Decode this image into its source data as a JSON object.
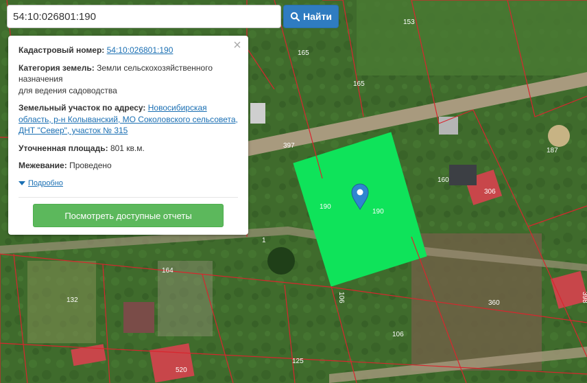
{
  "search": {
    "value": "54:10:026801:190",
    "button_label": "Найти"
  },
  "popup": {
    "cadastral_label": "Кадастровый номер:",
    "cadastral_value": "54:10:026801:190",
    "category_label": "Категория земель:",
    "category_value_line1": "Земли сельскохозяйственного",
    "category_value_line2": "назначения",
    "category_value_line3": "для ведения садоводства",
    "address_label": "Земельный участок по адресу:",
    "address_value": "Новосибирская область, р-н Колыванский, МО Соколовского сельсовета, ДНТ \"Север\", участок № 315",
    "area_label": "Уточненная площадь:",
    "area_value": "801 кв.м.",
    "survey_label": "Межевание:",
    "survey_value": "Проведено",
    "details_label": "Подробно",
    "reports_button": "Посмотреть доступные отчеты",
    "close_symbol": "×"
  },
  "map": {
    "colors": {
      "selected_parcel": "#0fe35a",
      "parcel_border": "#d8262e",
      "road": "#a89a7e",
      "roof_red": "#c8464a",
      "marker": "#2f85d0"
    },
    "labels": {
      "l153": "153",
      "l165a": "165",
      "l165b": "165",
      "l397": "397",
      "l187": "187",
      "l190a": "190",
      "l190b": "190",
      "l160": "160",
      "l306": "306",
      "l1": "1",
      "l164": "164",
      "l132": "132",
      "l106a": "106",
      "l106b": "106",
      "l360": "360",
      "l398": "398",
      "l125": "125",
      "l520": "520"
    }
  }
}
